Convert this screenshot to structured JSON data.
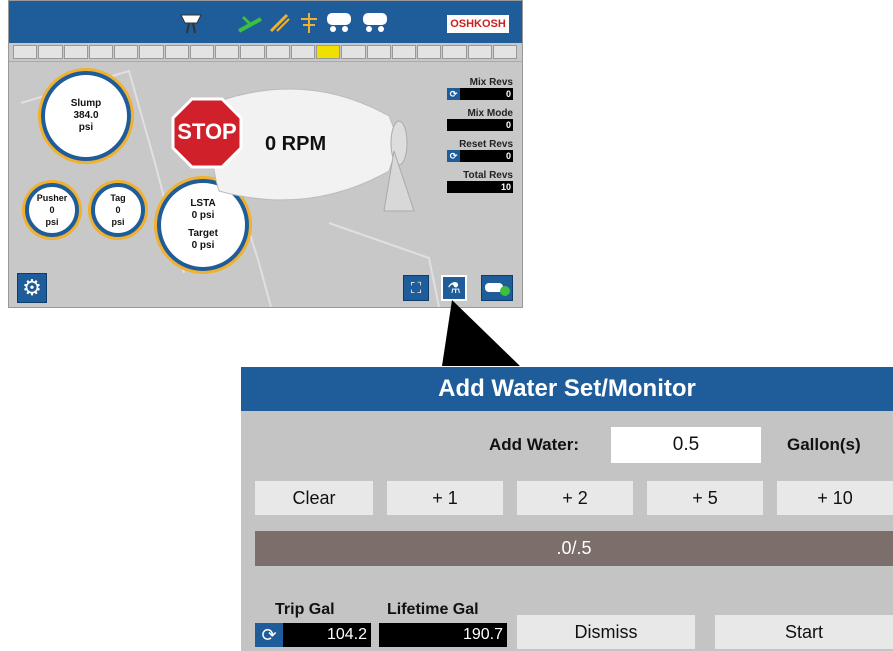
{
  "top_screen": {
    "brand_logo": "OSHKOSH",
    "gauges": {
      "slump": {
        "label": "Slump",
        "value": "384.0",
        "unit": "psi"
      },
      "pusher": {
        "label": "Pusher",
        "value": "0",
        "unit": "psi"
      },
      "tag": {
        "label": "Tag",
        "value": "0",
        "unit": "psi"
      },
      "lsta": {
        "label": "LSTA",
        "value": "0 psi",
        "target_label": "Target",
        "target_value": "0 psi"
      }
    },
    "stop_sign": "STOP",
    "rpm": "0 RPM",
    "revs": {
      "mix_revs": {
        "label": "Mix Revs",
        "value": "0"
      },
      "mix_mode": {
        "label": "Mix Mode",
        "value": "0"
      },
      "reset_revs": {
        "label": "Reset Revs",
        "value": "0"
      },
      "total_revs": {
        "label": "Total Revs",
        "value": "10"
      }
    },
    "segments_total": 20,
    "segment_active_index": 12,
    "refresh_glyph": "⟳"
  },
  "dialog": {
    "title": "Add Water Set/Monitor",
    "add_water_label": "Add Water:",
    "add_water_value": "0.5",
    "unit": "Gallon(s)",
    "buttons": {
      "clear": "Clear",
      "plus1": "+ 1",
      "plus2": "+ 2",
      "plus5": "+ 5",
      "plus10": "+ 10"
    },
    "progress_text": ".0/.5",
    "trip_gal_label": "Trip Gal",
    "trip_gal_value": "104.2",
    "lifetime_gal_label": "Lifetime Gal",
    "lifetime_gal_value": "190.7",
    "dismiss": "Dismiss",
    "start": "Start",
    "refresh_glyph": "⟳"
  },
  "colors": {
    "accent": "#1e5c9a",
    "gauge_ring": "#f0b030",
    "stop": "#d0202a",
    "segment_active": "#f0e000",
    "progress_bg": "#7b6e6b"
  }
}
